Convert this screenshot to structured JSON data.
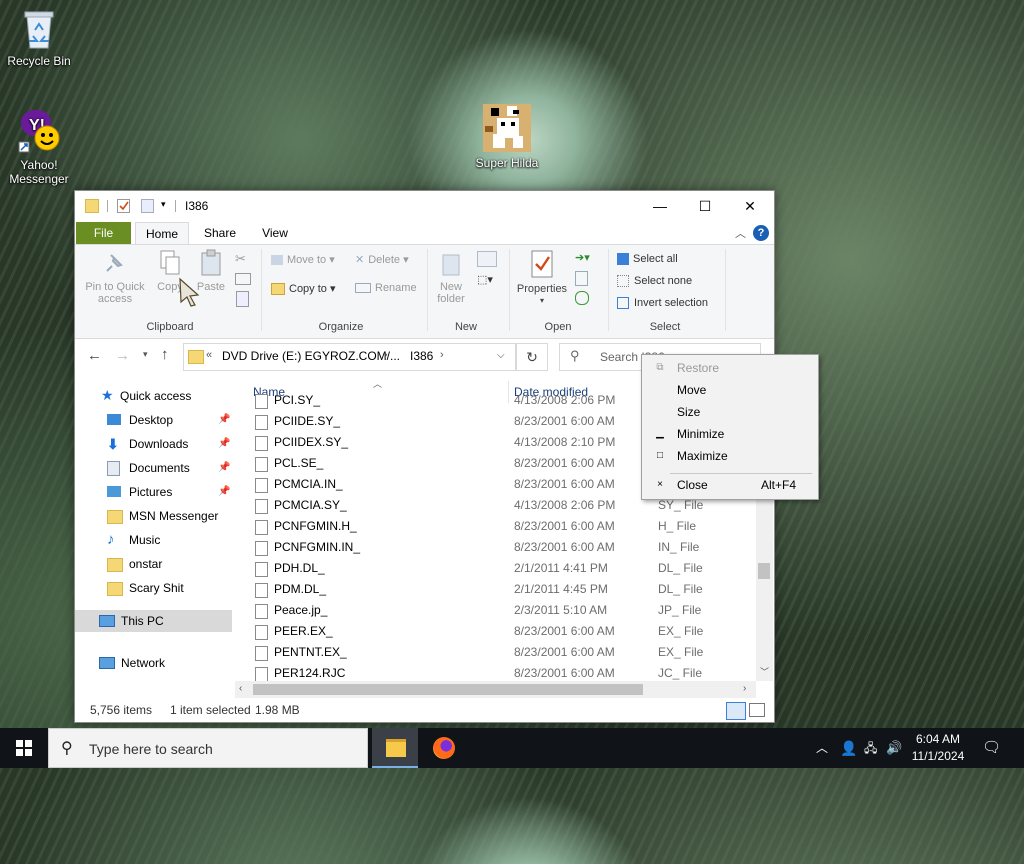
{
  "desktop": {
    "icons": [
      {
        "label": "Recycle Bin"
      },
      {
        "label": "Yahoo!\nMessenger"
      },
      {
        "label": "Super Hilda"
      }
    ]
  },
  "window": {
    "title": "I386",
    "ribbon_tabs": [
      "File",
      "Home",
      "Share",
      "View"
    ],
    "ribbon": {
      "clipboard": {
        "pin": "Pin to Quick access",
        "copy": "Copy",
        "paste": "Paste",
        "group": "Clipboard"
      },
      "organize": {
        "move_to": "Move to",
        "copy_to": "Copy to",
        "delete": "Delete",
        "rename": "Rename",
        "group": "Organize"
      },
      "new": {
        "new_folder": "New folder",
        "group": "New"
      },
      "open": {
        "properties": "Properties",
        "group": "Open"
      },
      "select": {
        "select_all": "Select all",
        "select_none": "Select none",
        "invert": "Invert selection",
        "group": "Select"
      }
    },
    "address": {
      "path": "DVD Drive (E:) EGYROZ.COM/...",
      "current": "I386",
      "search_placeholder": "Search I386"
    },
    "nav": {
      "quick_access": "Quick access",
      "items": [
        "Desktop",
        "Downloads",
        "Documents",
        "Pictures",
        "MSN Messenger",
        "Music",
        "onstar",
        "Scary Shit"
      ],
      "this_pc": "This PC",
      "network": "Network"
    },
    "columns": {
      "name": "Name",
      "date": "Date modified"
    },
    "files": [
      {
        "name": "PCI.SY_",
        "date": "4/13/2008 2:06 PM",
        "type": ""
      },
      {
        "name": "PCIIDE.SY_",
        "date": "8/23/2001 6:00 AM",
        "type": ""
      },
      {
        "name": "PCIIDEX.SY_",
        "date": "4/13/2008 2:10 PM",
        "type": ""
      },
      {
        "name": "PCL.SE_",
        "date": "8/23/2001 6:00 AM",
        "type": ""
      },
      {
        "name": "PCMCIA.IN_",
        "date": "8/23/2001 6:00 AM",
        "type": ""
      },
      {
        "name": "PCMCIA.SY_",
        "date": "4/13/2008 2:06 PM",
        "type": "SY_ File"
      },
      {
        "name": "PCNFGMIN.H_",
        "date": "8/23/2001 6:00 AM",
        "type": "H_ File"
      },
      {
        "name": "PCNFGMIN.IN_",
        "date": "8/23/2001 6:00 AM",
        "type": "IN_ File"
      },
      {
        "name": "PDH.DL_",
        "date": "2/1/2011 4:41 PM",
        "type": "DL_ File"
      },
      {
        "name": "PDM.DL_",
        "date": "2/1/2011 4:45 PM",
        "type": "DL_ File"
      },
      {
        "name": "Peace.jp_",
        "date": "2/3/2011 5:10 AM",
        "type": "JP_ File"
      },
      {
        "name": "PEER.EX_",
        "date": "8/23/2001 6:00 AM",
        "type": "EX_ File"
      },
      {
        "name": "PENTNT.EX_",
        "date": "8/23/2001 6:00 AM",
        "type": "EX_ File"
      },
      {
        "name": "PER124.RJC",
        "date": "8/23/2001 6:00 AM",
        "type": "JC_ File"
      }
    ],
    "status": {
      "count": "5,756 items",
      "selected": "1 item selected",
      "size": "1.98 MB"
    }
  },
  "context_menu": {
    "items": [
      {
        "label": "Restore",
        "glyph": "⧉",
        "enabled": false
      },
      {
        "label": "Move",
        "glyph": "",
        "enabled": true
      },
      {
        "label": "Size",
        "glyph": "",
        "enabled": true
      },
      {
        "label": "Minimize",
        "glyph": "▁",
        "enabled": true
      },
      {
        "label": "Maximize",
        "glyph": "□",
        "enabled": true
      },
      {
        "label": "Close",
        "glyph": "×",
        "enabled": true,
        "shortcut": "Alt+F4"
      }
    ]
  },
  "taskbar": {
    "search_placeholder": "Type here to search",
    "time": "6:04 AM",
    "date": "11/1/2024"
  },
  "colors": {
    "file_tab": "#6b8e23",
    "accent": "#1a5fb4",
    "taskbar": "#101418"
  }
}
